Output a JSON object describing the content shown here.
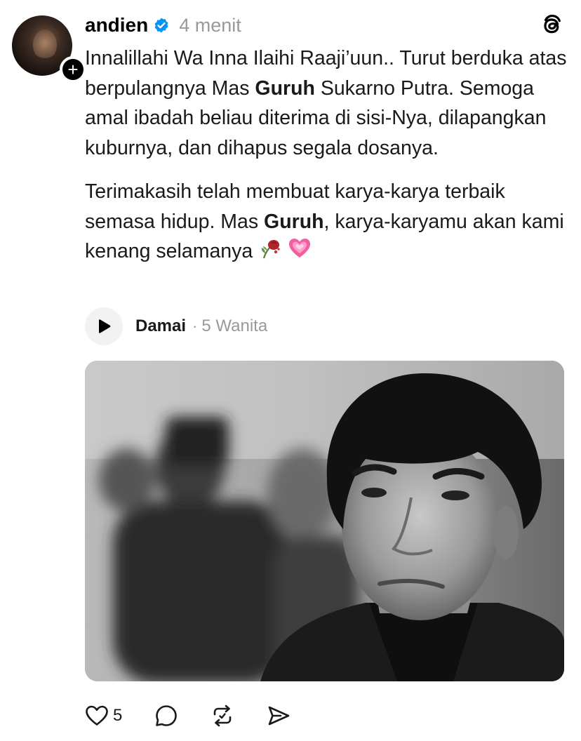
{
  "post": {
    "author": "andien",
    "verified": true,
    "timestamp": "4 menit",
    "follow_symbol": "+",
    "paragraph1": {
      "part1": "Innalillahi Wa Inna Ilaihi Raaji’uun.. Turut berduka atas berpulangnya Mas ",
      "bold1": "Guruh",
      "part2": " Sukarno Putra. Semoga amal ibadah beliau diterima di sisi-Nya, dilapangkan kuburnya, dan dihapus segala dosanya."
    },
    "paragraph2": {
      "part1": "Terimakasih telah membuat karya-karya terbaik semasa hidup. Mas ",
      "bold1": "Guruh",
      "part2": ", karya-karyamu akan kami kenang selamanya",
      "emojis": [
        "wilted-rose",
        "growing-heart"
      ]
    },
    "music": {
      "title": "Damai",
      "separator": "·",
      "artist": "5 Wanita"
    },
    "image": {
      "subject": "black-and-white portrait photo",
      "style": "monochrome"
    },
    "actions": {
      "like_count": "5",
      "icons": [
        "heart-icon",
        "comment-icon",
        "repost-icon",
        "share-icon"
      ]
    }
  },
  "colors": {
    "text": "#1a1a1a",
    "muted": "#999999",
    "verified": "#0095f6",
    "background": "#ffffff"
  }
}
